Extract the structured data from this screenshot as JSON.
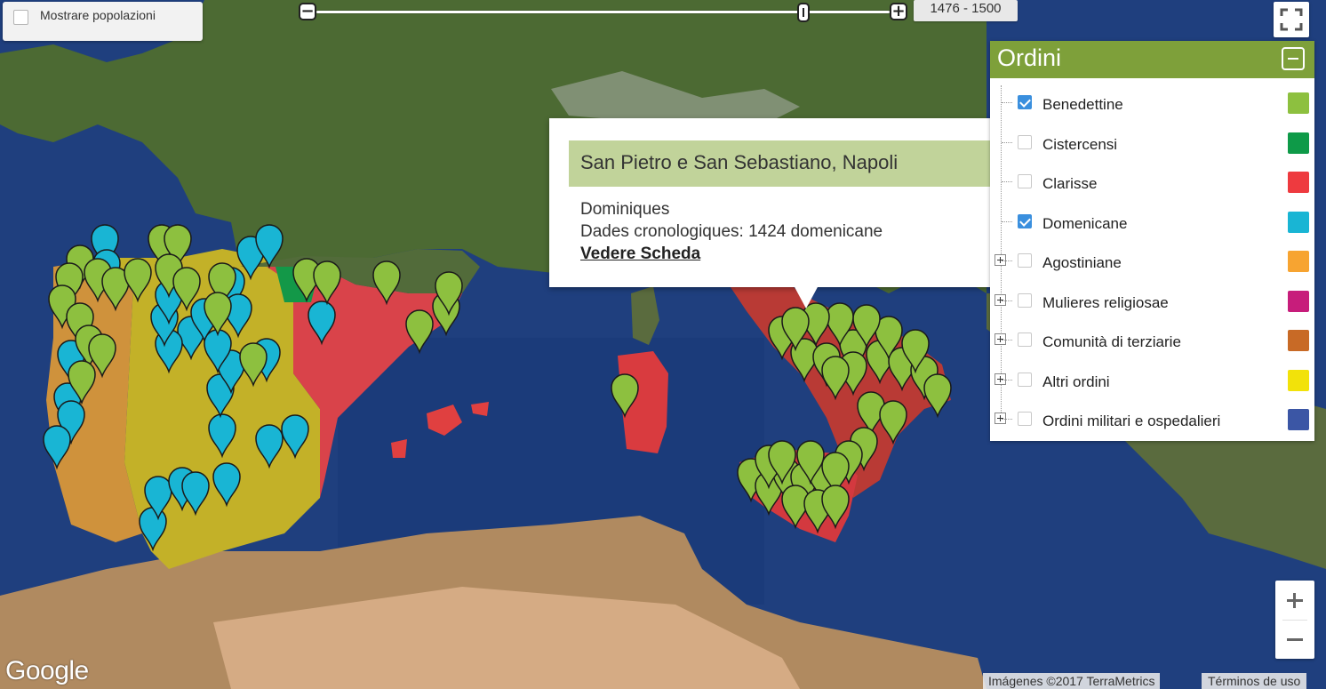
{
  "map_controls": {
    "show_populations_label": "Mostrare popolazioni",
    "show_populations_checked": false,
    "time_slider": {
      "range_label": "1476 - 1500",
      "minus_symbol": "−",
      "plus_symbol": "+",
      "position_fraction": 0.85
    },
    "fullscreen_icon": "fullscreen-icon"
  },
  "popup": {
    "title": "San Pietro e San Sebastiano, Napoli",
    "order": "Dominiques",
    "chronology": "Dades cronologiques: 1424 domenicane",
    "link": "Vedere Scheda"
  },
  "orders_panel": {
    "title": "Ordini",
    "collapse_icon": "minus-square-icon",
    "items": [
      {
        "label": "Benedettine",
        "checked": true,
        "expandable": false,
        "color": "#8dc03f"
      },
      {
        "label": "Cistercensi",
        "checked": false,
        "expandable": false,
        "color": "#0e9a48"
      },
      {
        "label": "Clarisse",
        "checked": false,
        "expandable": false,
        "color": "#ee3a3f"
      },
      {
        "label": "Domenicane",
        "checked": true,
        "expandable": false,
        "color": "#19b5d4"
      },
      {
        "label": "Agostiniane",
        "checked": false,
        "expandable": true,
        "color": "#f7a431"
      },
      {
        "label": "Mulieres religiosae",
        "checked": false,
        "expandable": true,
        "color": "#c71d7b"
      },
      {
        "label": "Comunità di terziarie",
        "checked": false,
        "expandable": true,
        "color": "#c86a26"
      },
      {
        "label": "Altri ordini",
        "checked": false,
        "expandable": true,
        "color": "#f2e20a"
      },
      {
        "label": "Ordini militari e ospedalieri",
        "checked": false,
        "expandable": true,
        "color": "#3b56a5"
      }
    ]
  },
  "zoom": {
    "in_icon": "plus-icon",
    "out_icon": "minus-icon"
  },
  "footer": {
    "logo": "Google",
    "attribution": "Imágenes ©2017 TerraMetrics",
    "terms": "Términos de uso"
  }
}
